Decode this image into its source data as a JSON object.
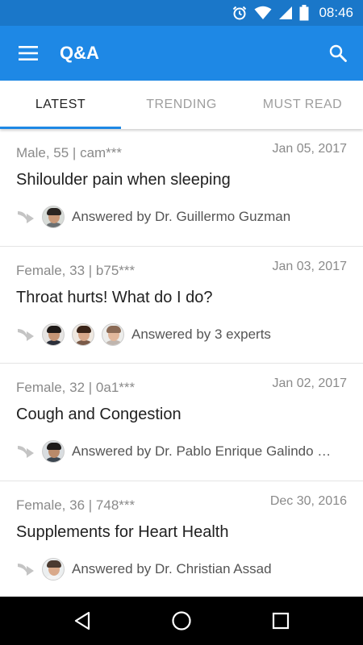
{
  "status_bar": {
    "time": "08:46",
    "icons": [
      "alarm-icon",
      "wifi-icon",
      "signal-icon",
      "battery-icon"
    ]
  },
  "app_bar": {
    "title": "Q&A",
    "menu_icon": "hamburger-menu-icon",
    "search_icon": "search-icon",
    "color": "#1e88e5"
  },
  "tabs": [
    {
      "label": "LATEST",
      "active": true
    },
    {
      "label": "TRENDING",
      "active": false
    },
    {
      "label": "MUST READ",
      "active": false
    }
  ],
  "questions": [
    {
      "meta": "Male, 55  |  cam***",
      "date": "Jan 05, 2017",
      "title": "Shiloulder pain when sleeping",
      "answered": "Answered by Dr. Guillermo Guzman",
      "avatars": 1
    },
    {
      "meta": "Female, 33  |  b75***",
      "date": "Jan 03, 2017",
      "title": "Throat hurts! What do I do?",
      "answered": "Answered by 3 experts",
      "avatars": 3
    },
    {
      "meta": "Female, 32  |  0a1***",
      "date": "Jan 02, 2017",
      "title": "Cough and Congestion",
      "answered": "Answered by Dr. Pablo Enrique Galindo …",
      "avatars": 1
    },
    {
      "meta": "Female, 36  |  748***",
      "date": "Dec 30, 2016",
      "title": "Supplements for Heart Health",
      "answered": "Answered by Dr. Christian Assad",
      "avatars": 1
    }
  ],
  "nav_bar": {
    "icons": [
      "back-icon",
      "home-icon",
      "recents-icon"
    ]
  }
}
